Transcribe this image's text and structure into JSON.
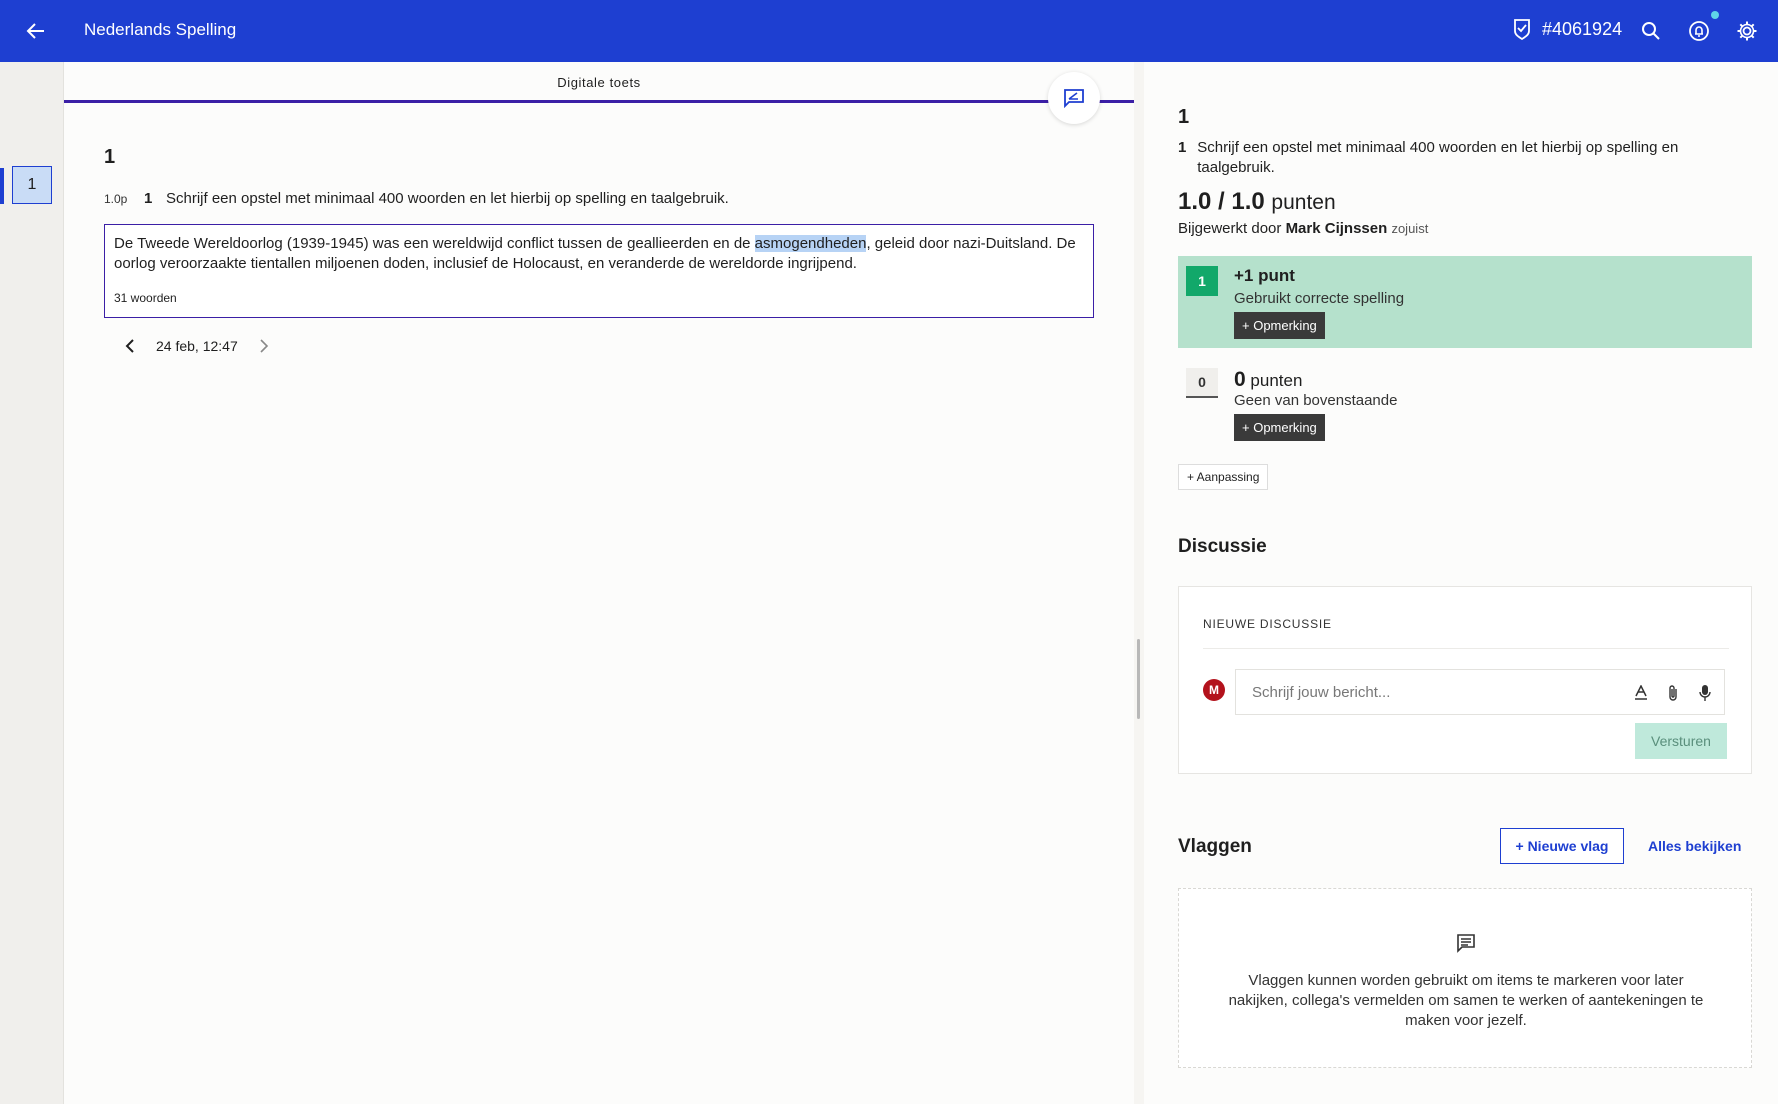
{
  "header": {
    "title": "Nederlands Spelling",
    "badge_id": "#4061924",
    "icons": [
      "arrow-left-icon",
      "shield-check-icon",
      "search-icon",
      "bell-icon",
      "gear-icon"
    ]
  },
  "rail": {
    "items": [
      {
        "label": "1",
        "selected": true
      }
    ]
  },
  "main": {
    "tab": "Digitale toets",
    "question_number": "1",
    "question": {
      "points": "1.0p",
      "index": "1",
      "text": "Schrijf een opstel met minimaal 400 woorden en let hierbij op spelling en taalgebruik."
    },
    "answer": {
      "before": "De Tweede Wereldoorlog (1939-1945) was een wereldwijd conflict tussen de geallieerden en de ",
      "highlight": "asmogendheden",
      "after": ", geleid door nazi-Duitsland. De oorlog veroorzaakte tientallen miljoenen doden, inclusief de Holocaust, en veranderde de wereldorde ingrijpend.",
      "word_count": "31 woorden"
    },
    "timestamp": "24 feb, 12:47"
  },
  "review": {
    "question_number": "1",
    "question_index": "1",
    "question_text": "Schrijf een opstel met minimaal 400 woorden en let hierbij op spelling en taalgebruik.",
    "score": "1.0 / 1.0",
    "score_unit": "punten",
    "updated_prefix": "Bijgewerkt door",
    "updated_by": "Mark Cijnssen",
    "updated_when": "zojuist",
    "criteria": [
      {
        "badge": "1",
        "title": "+1 punt",
        "desc": "Gebruikt correcte spelling",
        "remark": "+ Opmerking",
        "selected": true
      },
      {
        "badge": "0",
        "points": "0",
        "points_label": "punten",
        "desc": "Geen van bovenstaande",
        "remark": "+ Opmerking",
        "selected": false
      }
    ],
    "adjust_label": "+ Aanpassing"
  },
  "discussion": {
    "title": "Discussie",
    "label": "NIEUWE DISCUSSIE",
    "avatar_initial": "M",
    "placeholder": "Schrijf jouw bericht...",
    "send_label": "Versturen"
  },
  "flags": {
    "title": "Vlaggen",
    "new_label": "+ Nieuwe vlag",
    "all_label": "Alles bekijken",
    "empty_text": "Vlaggen kunnen worden gebruikt om items te markeren voor later nakijken, collega's vermelden om samen te werken of aantekeningen te maken voor jezelf."
  },
  "colors": {
    "primary": "#1e3fd1",
    "accent_purple": "#3b1fa6",
    "success": "#12a86a",
    "success_bg": "#b5e1cc",
    "avatar": "#b3121c"
  }
}
